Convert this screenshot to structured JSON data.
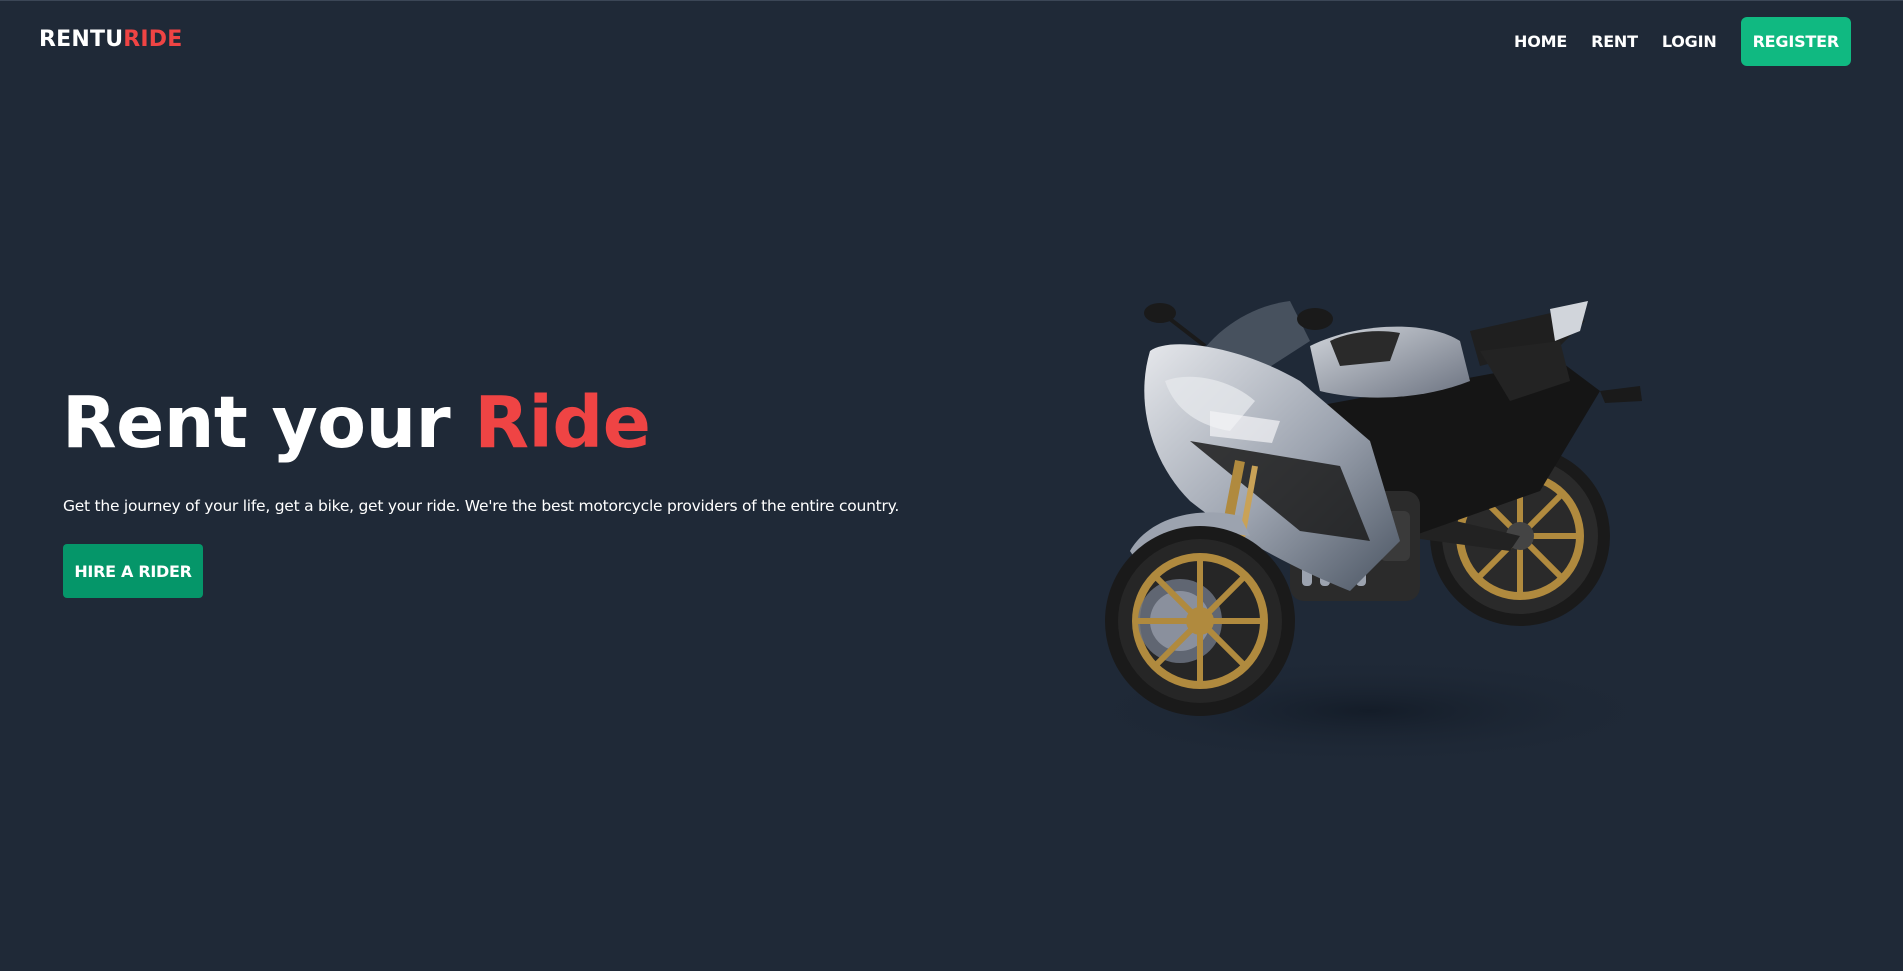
{
  "nav": {
    "logo_main": "RENTU",
    "logo_accent": "RIDE",
    "links": [
      "HOME",
      "RENT",
      "LOGIN"
    ],
    "register_label": "REGISTER"
  },
  "hero": {
    "title_main": "Rent your ",
    "title_accent": "Ride",
    "subtitle": "Get the journey of your life, get a bike, get your ride. We're the best motorcycle providers of the entire country.",
    "cta_label": "HIRE A RIDER"
  },
  "colors": {
    "background": "#1f2937",
    "accent_red": "#ef4444",
    "register_green": "#10b981",
    "cta_green": "#059669"
  },
  "image": {
    "subject": "motorcycle-image"
  }
}
